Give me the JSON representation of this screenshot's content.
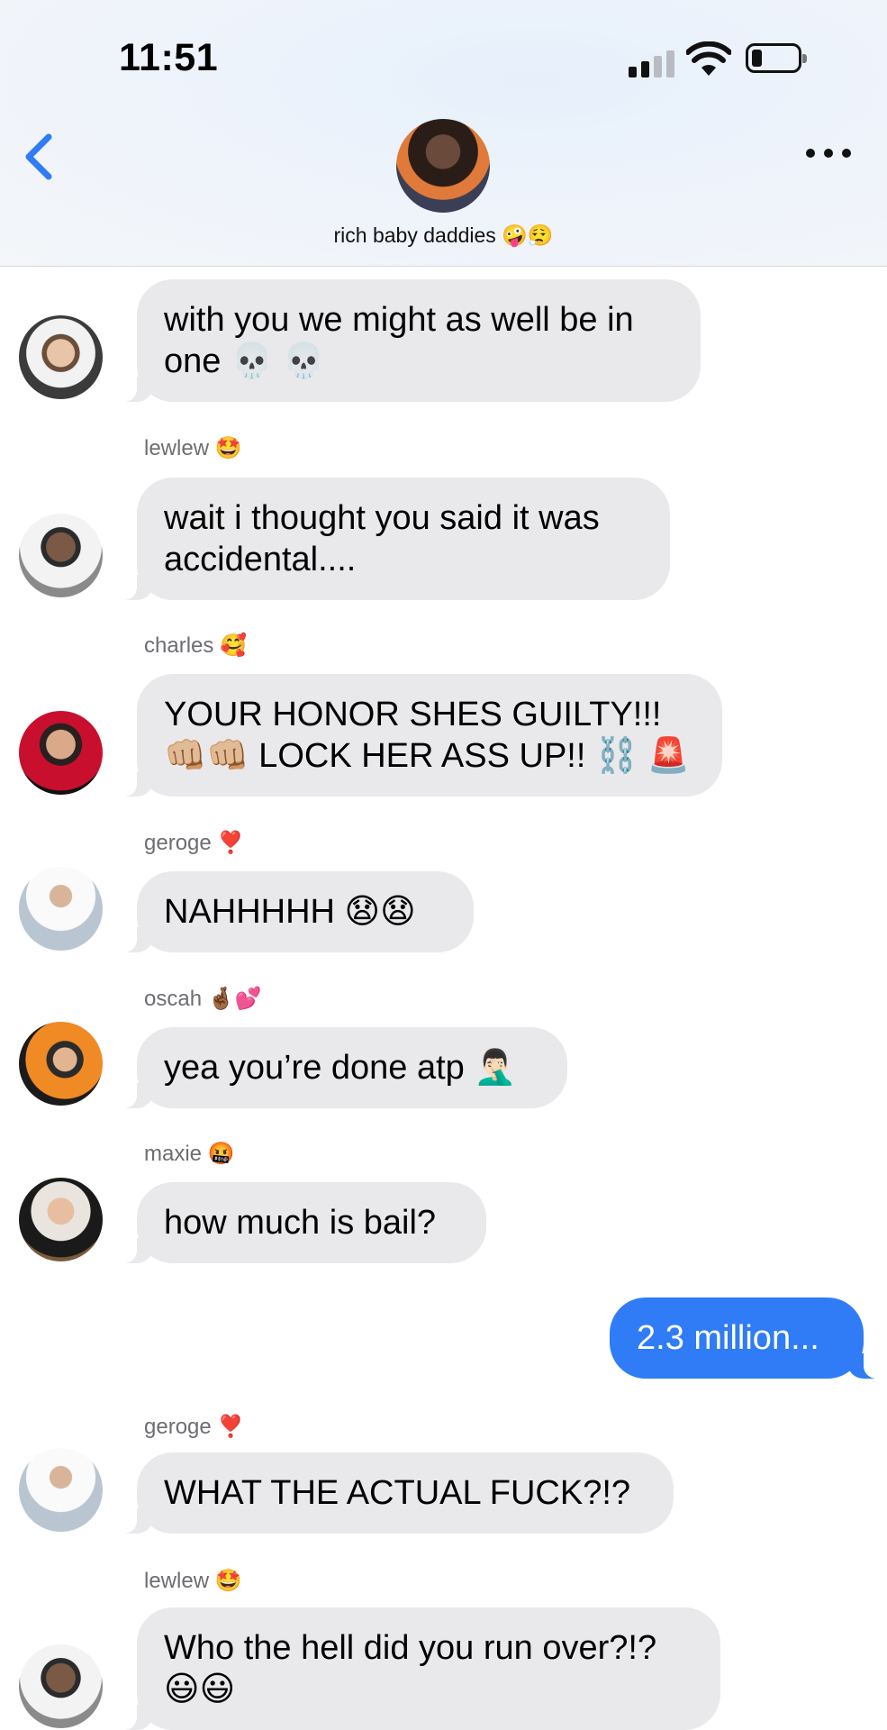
{
  "status_bar": {
    "time": "11:51"
  },
  "header": {
    "group_name": "rich baby daddies 🤪😮‍💨"
  },
  "messages": [
    {
      "sender": "",
      "text": "with you we might as well be in one 💀 💀"
    },
    {
      "sender": "lewlew 🤩",
      "text": "wait i thought you said it was accidental...."
    },
    {
      "sender": "charles 🥰",
      "text": "YOUR HONOR SHES GUILTY!!! 👊🏼👊🏼 LOCK HER ASS UP!! ⛓️ 🚨"
    },
    {
      "sender": "geroge ❣️",
      "text": "NAHHHHH 😧😧"
    },
    {
      "sender": "oscah 🤞🏾💕",
      "text": "yea you’re done atp 🤦🏻‍♂️"
    },
    {
      "sender": "maxie 🤬",
      "text": "how much is bail?"
    },
    {
      "sender": "",
      "text": "2.3 million..."
    },
    {
      "sender": "geroge ❣️",
      "text": "WHAT THE ACTUAL FUCK?!?"
    },
    {
      "sender": "lewlew 🤩",
      "text": "Who the hell did you run over?!? 😃😃"
    }
  ],
  "colors": {
    "outgoing_bubble": "#2f7cf6",
    "incoming_bubble": "#e9e9eb",
    "accent": "#2f7cf6"
  }
}
